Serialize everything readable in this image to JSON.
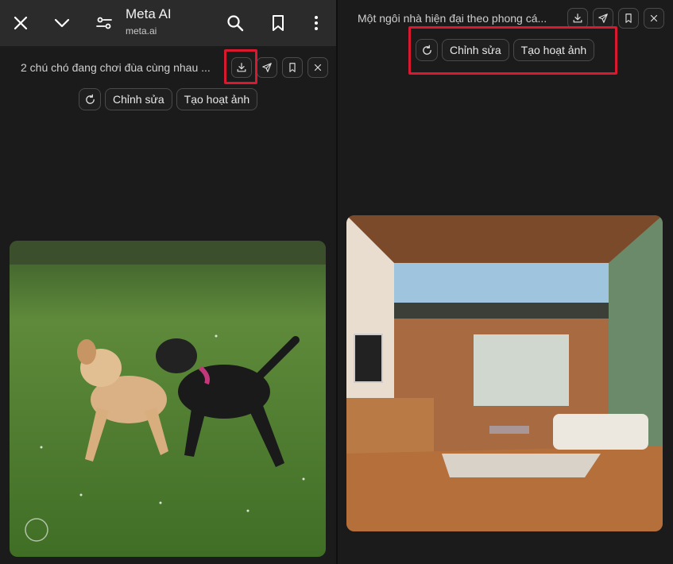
{
  "left": {
    "appbar": {
      "title": "Meta AI",
      "subtitle": "meta.ai",
      "icons": [
        "close-icon",
        "chevron-down-icon",
        "filter-icon",
        "search-icon",
        "bookmark-icon",
        "more-vertical-icon"
      ]
    },
    "prompt": "2 chú chó đang chơi đùa cùng nhau ...",
    "actions": [
      "download-icon",
      "send-icon",
      "bookmark-icon",
      "close-icon"
    ],
    "chips": {
      "edit": "Chỉnh sửa",
      "animate": "Tạo hoạt ảnh"
    }
  },
  "right": {
    "prompt": "Một ngôi nhà hiện đại theo phong cá...",
    "actions": [
      "download-icon",
      "send-icon",
      "bookmark-icon",
      "close-icon"
    ],
    "chips": {
      "edit": "Chỉnh sửa",
      "animate": "Tạo hoạt ảnh"
    }
  },
  "colors": {
    "highlight": "#d8192f",
    "appbar": "#2b2b2b",
    "background": "#1b1b1b"
  }
}
